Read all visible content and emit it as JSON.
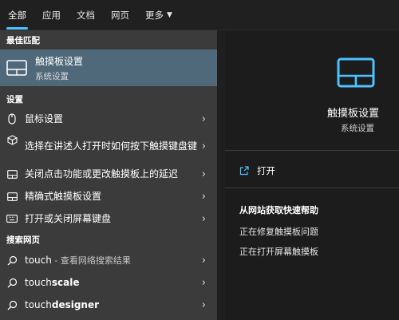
{
  "tabs": [
    {
      "label": "全部"
    },
    {
      "label": "应用"
    },
    {
      "label": "文档"
    },
    {
      "label": "网页"
    },
    {
      "label": "更多"
    }
  ],
  "best_match": {
    "section": "最佳匹配",
    "title": "触摸板设置",
    "subtitle": "系统设置",
    "icon": "touchpad-icon"
  },
  "settings": {
    "section": "设置",
    "items": [
      {
        "label": "鼠标设置",
        "icon": "mouse-icon"
      },
      {
        "label": "选择在讲述人打开时如何按下触摸键盘键",
        "icon": "cube-icon"
      },
      {
        "label": "关闭点击功能或更改触摸板上的延迟",
        "icon": "touchpad-icon"
      },
      {
        "label": "精确式触摸板设置",
        "icon": "touchpad-icon"
      },
      {
        "label": "打开或关闭屏幕键盘",
        "icon": "keyboard-icon"
      }
    ]
  },
  "web": {
    "section": "搜索网页",
    "items": [
      {
        "prefix": "touch",
        "suffix": " - 查看网络搜索结果",
        "bold": ""
      },
      {
        "prefix": "touch",
        "suffix": "",
        "bold": "scale"
      },
      {
        "prefix": "touch",
        "suffix": "",
        "bold": "designer"
      }
    ]
  },
  "preview": {
    "title": "触摸板设置",
    "subtitle": "系统设置",
    "open_label": "打开",
    "help_title": "从网站获取快速帮助",
    "help_items": [
      "正在修复触摸板问题",
      "正在打开屏幕触摸板"
    ]
  },
  "colors": {
    "accent": "#4cc2ff",
    "selected_row": "#50697a",
    "left_panel": "#3b3b3b",
    "right_panel": "#1c1c1c"
  }
}
